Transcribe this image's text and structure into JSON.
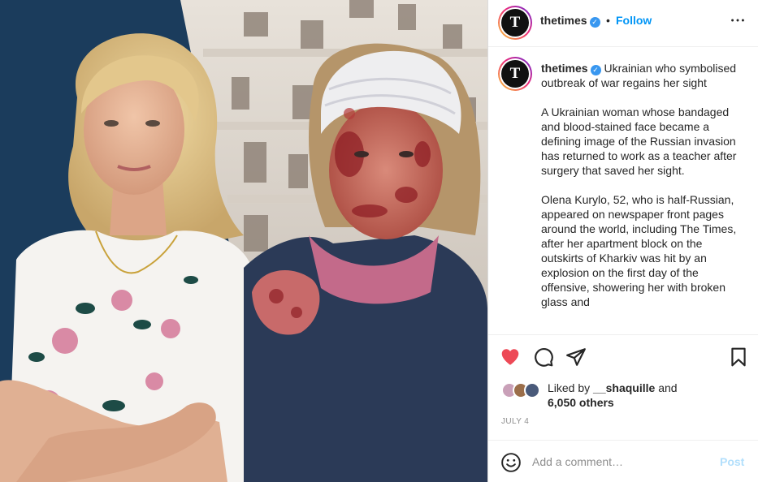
{
  "post": {
    "image_icon": "photo-two-women",
    "username": "thetimes",
    "avatar_letter": "T",
    "verified_icon": "verified-badge-icon",
    "separator": "•",
    "follow_label": "Follow",
    "more_icon": "more-horizontal-icon",
    "caption": {
      "title": "Ukrainian who symbolised outbreak of war regains her sight",
      "paragraphs": [
        "A Ukrainian woman whose bandaged and blood-stained face became a defining image of the Russian invasion has returned to work as a teacher after surgery that saved her sight.",
        "Olena Kurylo, 52, who is half-Russian, appeared on newspaper front pages around the world, including The Times, after her apartment block on the outskirts of Kharkiv was hit by an explosion on the first day of the offensive, showering her with broken glass and"
      ]
    },
    "actions": {
      "like_icon": "heart-filled-icon",
      "comment_icon": "comment-icon",
      "share_icon": "share-icon",
      "save_icon": "bookmark-icon",
      "like_color": "#ed4956"
    },
    "likes": {
      "prefix": "Liked by",
      "user": "__shaquille",
      "conjunction": "and",
      "others": "6,050 others"
    },
    "date": "JULY 4",
    "comment": {
      "emoji_icon": "emoji-smile-icon",
      "placeholder": "Add a comment…",
      "post_label": "Post"
    }
  },
  "colors": {
    "link_blue": "#0095f6",
    "post_disabled": "#b2dffc",
    "verified": "#3897f0",
    "photo_background": "#1b3c5c"
  }
}
